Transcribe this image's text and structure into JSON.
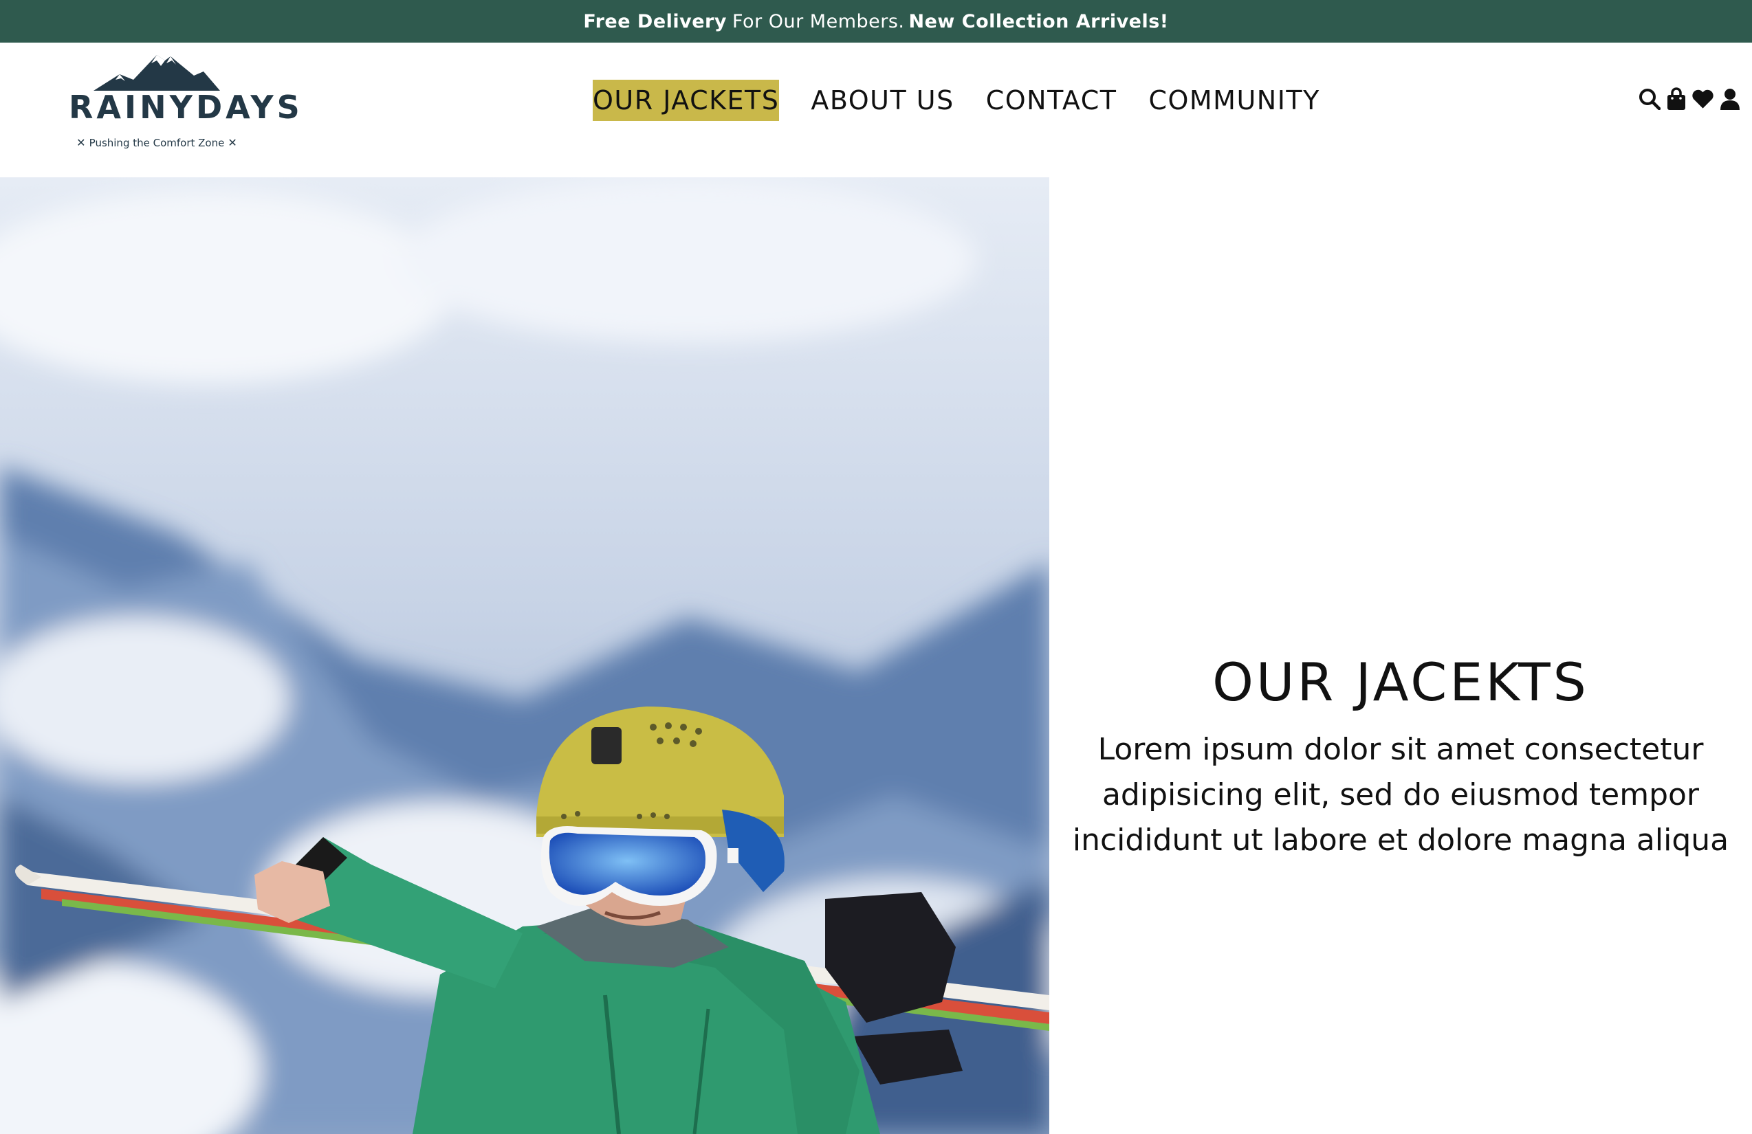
{
  "announcement": {
    "part1": "Free Delivery",
    "part2": "For Our Members.",
    "part3": "New Collection Arrivels!"
  },
  "brand": {
    "name": "RAINYDAYS",
    "tagline": "Pushing the Comfort Zone",
    "color": "#233846"
  },
  "nav": {
    "items": [
      "OUR JACKETS",
      "ABOUT US",
      "CONTACT",
      "COMMUNITY"
    ],
    "active_index": 0,
    "active_color": "#c9b84a"
  },
  "header_icons": [
    "search-icon",
    "shopping-bag-icon",
    "heart-icon",
    "user-icon"
  ],
  "hero": {
    "image": "skier-in-green-jacket-carrying-skis-on-snowy-mountain"
  },
  "main": {
    "title": "OUR JACEKTS",
    "body": "Lorem ipsum dolor sit amet consectetur adipisicing elit, sed do eiusmod tempor incididunt ut labore et dolore magna aliqua"
  },
  "colors": {
    "announcement_bg": "#2f5a4e",
    "accent": "#c9b84a",
    "text": "#111111"
  }
}
